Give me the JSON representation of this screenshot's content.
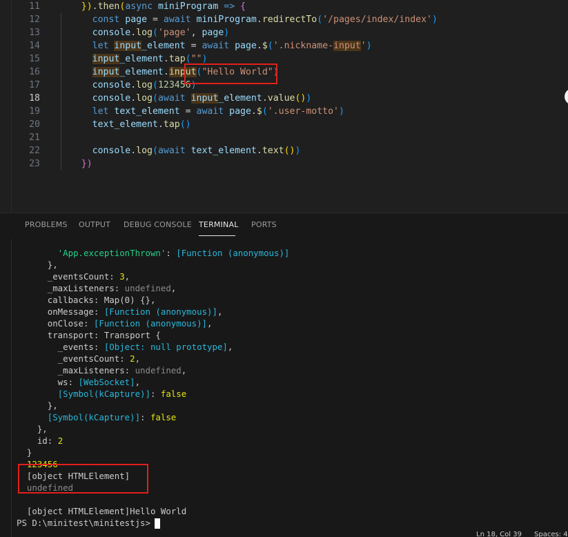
{
  "editor": {
    "lines": [
      {
        "no": "11",
        "tokens": [
          [
            "",
            "    "
          ],
          [
            "p1",
            "})"
          ],
          [
            "",
            "."
          ],
          [
            "f",
            "then"
          ],
          [
            "p1",
            "("
          ],
          [
            "k",
            "async "
          ],
          [
            "v",
            "miniProgram"
          ],
          [
            "k",
            " =>"
          ],
          [
            "",
            " "
          ],
          [
            "p2",
            "{"
          ]
        ]
      },
      {
        "no": "12",
        "tokens": [
          [
            "",
            "      "
          ],
          [
            "k",
            "const "
          ],
          [
            "v",
            "page"
          ],
          [
            "",
            " = "
          ],
          [
            "k",
            "await "
          ],
          [
            "v",
            "miniProgram"
          ],
          [
            "",
            "."
          ],
          [
            "f",
            "redirectTo"
          ],
          [
            "p3",
            "("
          ],
          [
            "s",
            "'/pages/index/index'"
          ],
          [
            "p3",
            ")"
          ]
        ]
      },
      {
        "no": "13",
        "tokens": [
          [
            "",
            "      "
          ],
          [
            "v",
            "console"
          ],
          [
            "",
            "."
          ],
          [
            "f",
            "log"
          ],
          [
            "p3",
            "("
          ],
          [
            "s",
            "'page'"
          ],
          [
            "",
            ", "
          ],
          [
            "v",
            "page"
          ],
          [
            "p3",
            ")"
          ]
        ]
      },
      {
        "no": "14",
        "tokens": [
          [
            "",
            "      "
          ],
          [
            "k",
            "let "
          ],
          [
            "v hl",
            "input"
          ],
          [
            "v",
            "_element"
          ],
          [
            "",
            " = "
          ],
          [
            "k",
            "await "
          ],
          [
            "v",
            "page"
          ],
          [
            "",
            "."
          ],
          [
            "f",
            "$"
          ],
          [
            "p3",
            "("
          ],
          [
            "s",
            "'.nickname-"
          ],
          [
            "s hl",
            "input"
          ],
          [
            "s",
            "'"
          ],
          [
            "p3",
            ")"
          ]
        ]
      },
      {
        "no": "15",
        "tokens": [
          [
            "",
            "      "
          ],
          [
            "v hl",
            "input"
          ],
          [
            "v",
            "_element"
          ],
          [
            "",
            "."
          ],
          [
            "f",
            "tap"
          ],
          [
            "p3",
            "("
          ],
          [
            "s",
            "\"\""
          ],
          [
            "p3",
            ")"
          ]
        ]
      },
      {
        "no": "16",
        "tokens": [
          [
            "",
            "      "
          ],
          [
            "v hl",
            "input"
          ],
          [
            "v",
            "_element"
          ],
          [
            "",
            "."
          ],
          [
            "f hl",
            "input"
          ],
          [
            "p3",
            "("
          ],
          [
            "s",
            "\"Hello World\""
          ],
          [
            "p3",
            ")"
          ]
        ]
      },
      {
        "no": "17",
        "tokens": [
          [
            "",
            "      "
          ],
          [
            "v",
            "console"
          ],
          [
            "",
            "."
          ],
          [
            "f",
            "log"
          ],
          [
            "p3",
            "("
          ],
          [
            "n",
            "123456"
          ],
          [
            "p3",
            ")"
          ]
        ]
      },
      {
        "no": "18",
        "tokens": [
          [
            "",
            "      "
          ],
          [
            "v",
            "console"
          ],
          [
            "",
            "."
          ],
          [
            "f",
            "log"
          ],
          [
            "p3",
            "("
          ],
          [
            "k",
            "await "
          ],
          [
            "v hl",
            "input"
          ],
          [
            "v",
            "_element"
          ],
          [
            "",
            "."
          ],
          [
            "f",
            "value"
          ],
          [
            "p1",
            "()"
          ],
          [
            "p3",
            ")"
          ]
        ]
      },
      {
        "no": "19",
        "tokens": [
          [
            "",
            "      "
          ],
          [
            "k",
            "let "
          ],
          [
            "v",
            "text_element"
          ],
          [
            "",
            " = "
          ],
          [
            "k",
            "await "
          ],
          [
            "v",
            "page"
          ],
          [
            "",
            "."
          ],
          [
            "f",
            "$"
          ],
          [
            "p3",
            "("
          ],
          [
            "s",
            "'.user-motto'"
          ],
          [
            "p3",
            ")"
          ]
        ]
      },
      {
        "no": "20",
        "tokens": [
          [
            "",
            "      "
          ],
          [
            "v",
            "text_element"
          ],
          [
            "",
            "."
          ],
          [
            "f",
            "tap"
          ],
          [
            "p3",
            "()"
          ]
        ]
      },
      {
        "no": "21",
        "tokens": []
      },
      {
        "no": "22",
        "tokens": [
          [
            "",
            "      "
          ],
          [
            "v",
            "console"
          ],
          [
            "",
            "."
          ],
          [
            "f",
            "log"
          ],
          [
            "p3",
            "("
          ],
          [
            "k",
            "await "
          ],
          [
            "v",
            "text_element"
          ],
          [
            "",
            "."
          ],
          [
            "f",
            "text"
          ],
          [
            "p1",
            "()"
          ],
          [
            "p3",
            ")"
          ]
        ]
      },
      {
        "no": "23",
        "tokens": [
          [
            "",
            "    "
          ],
          [
            "p2",
            "})"
          ]
        ]
      }
    ]
  },
  "panel": {
    "tabs": [
      {
        "label": "PROBLEMS"
      },
      {
        "label": "OUTPUT"
      },
      {
        "label": "DEBUG CONSOLE"
      },
      {
        "label": "TERMINAL",
        "active": true
      },
      {
        "label": "PORTS"
      }
    ]
  },
  "terminal": {
    "lines": [
      [
        [
          "",
          "        "
        ],
        [
          "t-str",
          "'App.exceptionThrown'"
        ],
        [
          "",
          ": "
        ],
        [
          "t-fn",
          "[Function (anonymous)]"
        ]
      ],
      [
        [
          "",
          "      },"
        ]
      ],
      [
        [
          "",
          "      _eventsCount: "
        ],
        [
          "t-num",
          "3"
        ],
        [
          "",
          ","
        ]
      ],
      [
        [
          "",
          "      _maxListeners: "
        ],
        [
          "t-dim",
          "undefined"
        ],
        [
          "",
          ","
        ]
      ],
      [
        [
          "",
          "      callbacks: Map(0) {},"
        ]
      ],
      [
        [
          "",
          "      onMessage: "
        ],
        [
          "t-fn",
          "[Function (anonymous)]"
        ],
        [
          "",
          ","
        ]
      ],
      [
        [
          "",
          "      onClose: "
        ],
        [
          "t-fn",
          "[Function (anonymous)]"
        ],
        [
          "",
          ","
        ]
      ],
      [
        [
          "",
          "      transport: Transport {"
        ]
      ],
      [
        [
          "",
          "        _events: "
        ],
        [
          "t-fn",
          "[Object: null prototype]"
        ],
        [
          "",
          ","
        ]
      ],
      [
        [
          "",
          "        _eventsCount: "
        ],
        [
          "t-num",
          "2"
        ],
        [
          "",
          ","
        ]
      ],
      [
        [
          "",
          "        _maxListeners: "
        ],
        [
          "t-dim",
          "undefined"
        ],
        [
          "",
          ","
        ]
      ],
      [
        [
          "",
          "        ws: "
        ],
        [
          "t-fn",
          "[WebSocket]"
        ],
        [
          "",
          ","
        ]
      ],
      [
        [
          "",
          "        "
        ],
        [
          "t-fn",
          "[Symbol(kCapture)]"
        ],
        [
          "",
          ": "
        ],
        [
          "t-num",
          "false"
        ]
      ],
      [
        [
          "",
          "      },"
        ]
      ],
      [
        [
          "",
          "      "
        ],
        [
          "t-fn",
          "[Symbol(kCapture)]"
        ],
        [
          "",
          ": "
        ],
        [
          "t-num",
          "false"
        ]
      ],
      [
        [
          "",
          "    },"
        ]
      ],
      [
        [
          "",
          "    id: "
        ],
        [
          "t-num",
          "2"
        ]
      ],
      [
        [
          "",
          "  }"
        ]
      ],
      [
        [
          "",
          "  "
        ],
        [
          "t-num",
          "123456"
        ]
      ],
      [
        [
          "",
          "  [object HTMLElement]"
        ]
      ],
      [
        [
          "",
          "  "
        ],
        [
          "t-dim",
          "undefined"
        ]
      ],
      [
        [
          "",
          ""
        ]
      ],
      [
        [
          "",
          "  [object HTMLElement]Hello World"
        ]
      ],
      [
        [
          "",
          "PS D:\\minitest\\minitestjs> "
        ]
      ]
    ]
  },
  "status": {
    "position": "Ln 18, Col 39",
    "spaces": "Spaces: 4"
  }
}
